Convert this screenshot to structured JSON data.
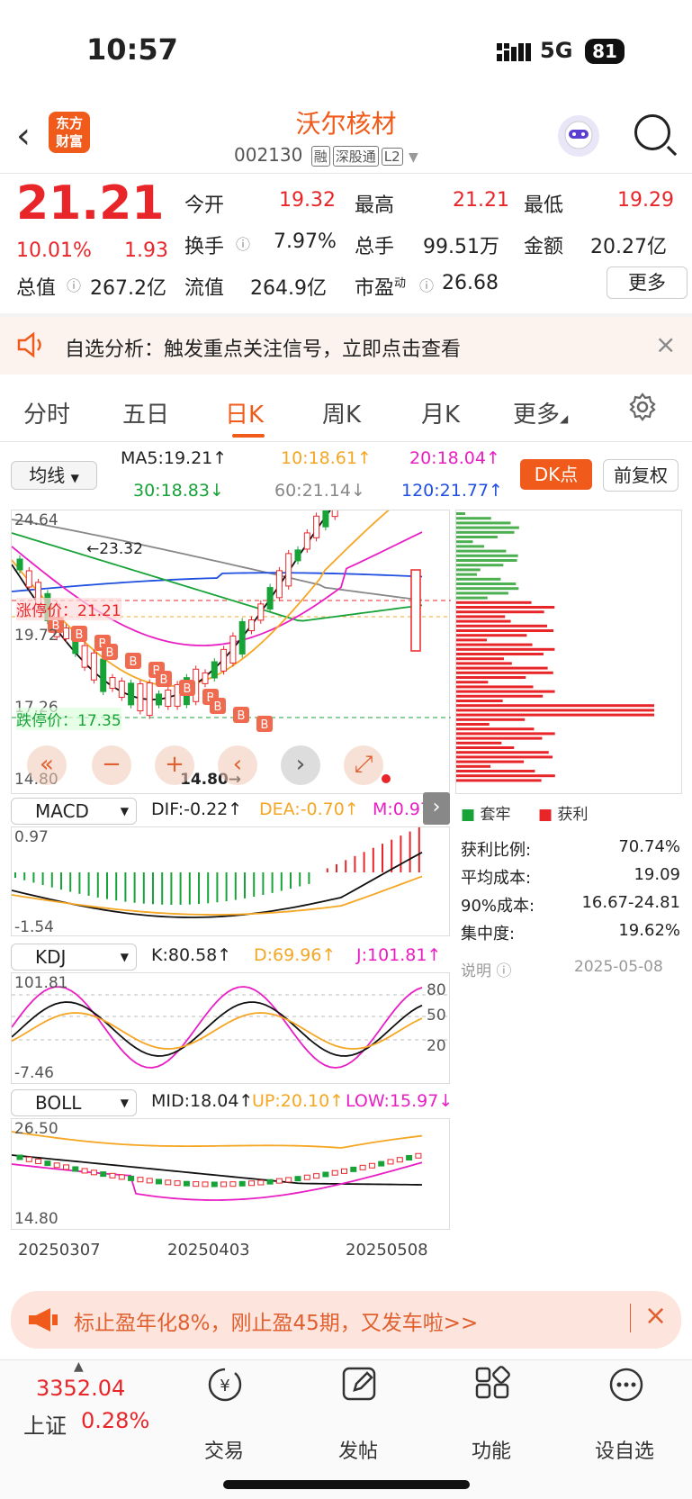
{
  "status": {
    "time": "10:57",
    "network": "5G",
    "battery": "81"
  },
  "header": {
    "logo_line1": "东方",
    "logo_line2": "财富",
    "title": "沃尔核材",
    "code": "002130",
    "tags": [
      "融",
      "深股通",
      "L2"
    ]
  },
  "quote": {
    "price": "21.21",
    "pct": "10.01%",
    "change": "1.93",
    "fields": [
      {
        "label": "今开",
        "value": "19.32"
      },
      {
        "label": "最高",
        "value": "21.21"
      },
      {
        "label": "最低",
        "value": "19.29"
      },
      {
        "label": "换手",
        "value": "7.97%"
      },
      {
        "label": "总手",
        "value": "99.51万"
      },
      {
        "label": "金额",
        "value": "20.27亿"
      },
      {
        "label": "总值",
        "value": "267.2亿"
      },
      {
        "label": "流值",
        "value": "264.9亿"
      },
      {
        "label": "市盈",
        "value": "26.68"
      }
    ],
    "pe_sup": "动",
    "more": "更多"
  },
  "notice": {
    "text": "自选分析：触发重点关注信号，立即点击查看"
  },
  "tabs": [
    "分时",
    "五日",
    "日K",
    "周K",
    "月K",
    "更多",
    "settings-icon"
  ],
  "active_tab": "日K",
  "ma_row": {
    "selector": "均线",
    "ma5": "MA5:19.21↑",
    "ma10": "10:18.61↑",
    "ma20": "20:18.04↑",
    "ma30": "30:18.83↓",
    "ma60": "60:21.14↓",
    "ma120": "120:21.77↑",
    "dk": "DK点",
    "fq": "前复权"
  },
  "kline": {
    "top": "24.64",
    "mid": "19.72",
    "low": "17.26",
    "bottom": "14.80",
    "limit_up": "涨停价：21.21",
    "limit_down": "跌停价：17.35",
    "hi_mark": "←23.32",
    "lo_mark": "14.80→",
    "colors": {
      "up": "#e8262a",
      "down": "#18a338",
      "ma5": "#111111",
      "ma10": "#f5a623",
      "ma20": "#e91fc4",
      "ma30": "#18a338",
      "ma60": "#888888",
      "ma120": "#1f4fe0"
    }
  },
  "chip": {
    "legend_trapped": "套牢",
    "legend_profit": "获利",
    "rows": [
      {
        "label": "获利比例:",
        "value": "70.74%"
      },
      {
        "label": "平均成本:",
        "value": "19.09"
      },
      {
        "label": "90%成本:",
        "value": "16.67-24.81"
      },
      {
        "label": "集中度:",
        "value": "19.62%"
      }
    ],
    "note": "说明",
    "date": "2025-05-08"
  },
  "macd": {
    "name": "MACD",
    "dif": "DIF:-0.22↑",
    "dea": "DEA:-0.70↑",
    "m": "M:0.97↑",
    "top": "0.97",
    "bottom": "-1.54"
  },
  "kdj": {
    "name": "KDJ",
    "k": "K:80.58↑",
    "d": "D:69.96↑",
    "j": "J:101.81↑",
    "top": "101.81",
    "bottom": "-7.46",
    "l80": "80",
    "l50": "50",
    "l20": "20"
  },
  "boll": {
    "name": "BOLL",
    "mid": "MID:18.04↑",
    "up": "UP:20.10↑",
    "low": "LOW:15.97↓",
    "top": "26.50",
    "bottom": "14.80"
  },
  "dates": [
    "20250307",
    "20250403",
    "20250508"
  ],
  "ad": {
    "text": "标止盈年化8%，刚止盈45期，又发车啦>>"
  },
  "bottom": {
    "index_value": "3352.04",
    "index_name": "上证",
    "index_pct": "0.28%",
    "items": [
      "交易",
      "发帖",
      "功能",
      "设自选"
    ]
  }
}
